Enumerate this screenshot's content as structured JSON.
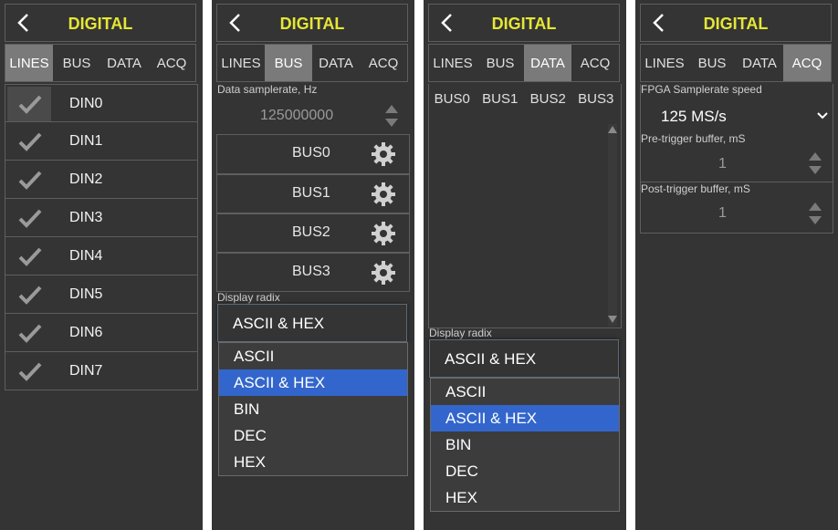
{
  "panels": [
    {
      "title": "DIGITAL",
      "tabs": [
        "LINES",
        "BUS",
        "DATA",
        "ACQ"
      ],
      "active_tab": "LINES",
      "lines": [
        "DIN0",
        "DIN1",
        "DIN2",
        "DIN3",
        "DIN4",
        "DIN5",
        "DIN6",
        "DIN7"
      ]
    },
    {
      "title": "DIGITAL",
      "tabs": [
        "LINES",
        "BUS",
        "DATA",
        "ACQ"
      ],
      "active_tab": "BUS",
      "samplerate_label": "Data samplerate, Hz",
      "samplerate_value": "125000000",
      "buses": [
        "BUS0",
        "BUS1",
        "BUS2",
        "BUS3"
      ],
      "radix_label": "Display radix",
      "radix_selected": "ASCII & HEX",
      "radix_options": [
        "ASCII",
        "ASCII & HEX",
        "BIN",
        "DEC",
        "HEX"
      ]
    },
    {
      "title": "DIGITAL",
      "tabs": [
        "LINES",
        "BUS",
        "DATA",
        "ACQ"
      ],
      "active_tab": "DATA",
      "bus_columns": [
        "BUS0",
        "BUS1",
        "BUS2",
        "BUS3"
      ],
      "radix_label": "Display radix",
      "radix_selected": "ASCII & HEX",
      "radix_options": [
        "ASCII",
        "ASCII & HEX",
        "BIN",
        "DEC",
        "HEX"
      ]
    },
    {
      "title": "DIGITAL",
      "tabs": [
        "LINES",
        "BUS",
        "DATA",
        "ACQ"
      ],
      "active_tab": "ACQ",
      "fpga_label": "FPGA Samplerate speed",
      "fpga_value": "125 MS/s",
      "pretrigger_label": "Pre-trigger buffer, mS",
      "pretrigger_value": "1",
      "posttrigger_label": "Post-trigger buffer, mS",
      "posttrigger_value": "1"
    }
  ],
  "colors": {
    "panel_bg": "#343434",
    "title": "#e6e635",
    "tab_active": "#7a7a7a",
    "option_highlight": "#3366cc"
  }
}
